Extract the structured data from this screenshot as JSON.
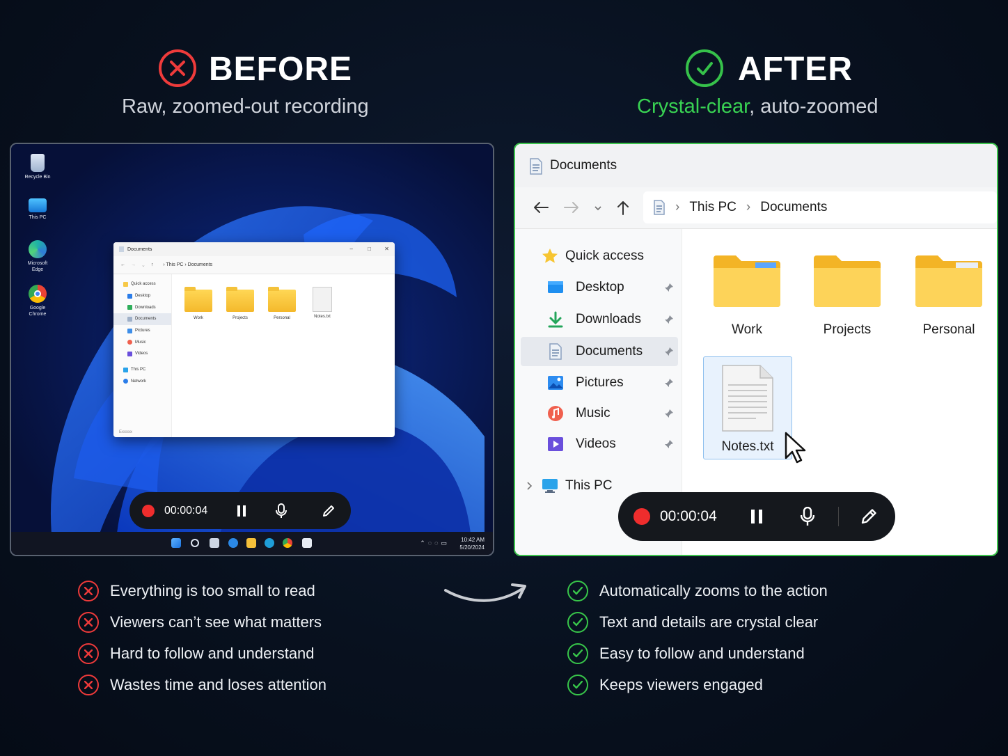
{
  "before": {
    "title": "BEFORE",
    "subtitle": "Raw, zoomed-out recording",
    "desktop_icons": [
      {
        "label_line1": "Recycle Bin",
        "label_line2": "",
        "icon": "recycle-bin-icon"
      },
      {
        "label_line1": "This PC",
        "label_line2": "",
        "icon": "monitor-icon"
      },
      {
        "label_line1": "Microsoft",
        "label_line2": "Edge",
        "icon": "edge-icon"
      },
      {
        "label_line1": "Google",
        "label_line2": "Chrome",
        "icon": "chrome-icon"
      }
    ],
    "window": {
      "title": "Documents",
      "breadcrumb": [
        "This PC",
        "Documents"
      ],
      "sidebar": [
        "Quick access",
        "Desktop",
        "Downloads",
        "Documents",
        "Pictures",
        "Music",
        "Videos",
        "This PC",
        "Network"
      ],
      "files": [
        "Work",
        "Projects",
        "Personal",
        "Notes.txt"
      ],
      "status": "Exxxxx"
    },
    "recorder": {
      "time": "00:00:04"
    },
    "clock": {
      "time": "10:42 AM",
      "date": "5/20/2024"
    }
  },
  "after": {
    "title": "AFTER",
    "subtitle_highlight": "Crystal-clear",
    "subtitle_rest": ", auto-zoomed",
    "window": {
      "title": "Documents",
      "breadcrumb": [
        "This PC",
        "Documents"
      ],
      "sidebar": {
        "quick_access": "Quick access",
        "items": [
          "Desktop",
          "Downloads",
          "Documents",
          "Pictures",
          "Music",
          "Videos"
        ],
        "this_pc": "This PC"
      },
      "files": [
        "Work",
        "Projects",
        "Personal",
        "Notes.txt"
      ]
    },
    "recorder": {
      "time": "00:00:04"
    }
  },
  "cons": [
    "Everything is too small to read",
    "Viewers can’t see what matters",
    "Hard to follow and understand",
    "Wastes time and loses attention"
  ],
  "pros": [
    "Automatically zooms to the action",
    "Text and details are crystal clear",
    "Easy to follow and understand",
    "Keeps viewers engaged"
  ],
  "colors": {
    "bad": "#ef3b3b",
    "good": "#39d353",
    "background": "#08111f",
    "folder": "#f6c338"
  }
}
